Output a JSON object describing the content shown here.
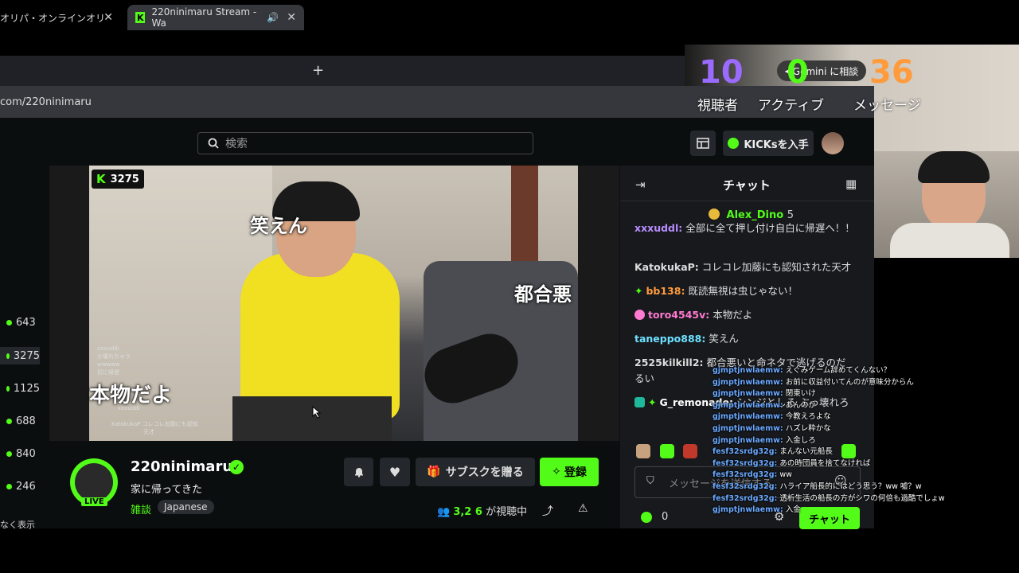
{
  "browser": {
    "tab1_label": "オリパ・オンラインオリパ",
    "tab2_label": "220ninimaru Stream - Wa",
    "tab_close": "✕",
    "new_tab": "+",
    "url": "com/220ninimaru"
  },
  "header": {
    "search_placeholder": "検索",
    "kicks_label": "KICKsを入手"
  },
  "sidebar": {
    "counts": [
      "643",
      "3275",
      "1125",
      "688",
      "840",
      "246"
    ],
    "show_less": "なく表示"
  },
  "video": {
    "viewer_badge": "3275",
    "overlay_1": "笑えん",
    "overlay_2": "都合悪",
    "overlay_3": "本物だよ",
    "mini_chat": [
      "xxxuddl",
      "xxxuddl",
      "か壊れちゃう",
      "wwwww",
      "初に帰遅",
      "KatokukaP コレコレ加藤にも認知",
      "天才"
    ]
  },
  "channel": {
    "name": "220ninimaru",
    "title": "家に帰ってきた",
    "category": "雑談",
    "tag": "Japanese",
    "live": "LIVE",
    "gift_sub": "サブスクを贈る",
    "register": "登録",
    "viewer_count": "3,2 6",
    "watching": "が視聴中"
  },
  "chat": {
    "title": "チャット",
    "pinned_user": "Alex_Dino",
    "pinned_count": "5",
    "messages": [
      {
        "user": "xxxuddl:",
        "text": "全部に全て押し付け自白に帰遅へ！！",
        "color": "#b98cff"
      },
      {
        "user": "KatokukaP:",
        "text": "コレコレ加藤にも認知された天才",
        "color": "#ddd"
      },
      {
        "user": "bb138:",
        "text": "既読無視は虫じゃない！",
        "color": "#ff9b3d"
      },
      {
        "user": "toro4545v:",
        "text": "本物だよ",
        "color": "#ff7ad1"
      },
      {
        "user": "taneppo888:",
        "text": "笑えん",
        "color": "#6de0ff"
      },
      {
        "user": "2525kilkill2:",
        "text": "都合悪いと命ネタで逃げるのだるい",
        "color": "#ddd"
      },
      {
        "user": "G_remonade:",
        "text": "シンジとしろ ぶっ壊れろ",
        "color": "#fff"
      }
    ],
    "input_placeholder": "メッセージを送信する",
    "points": "0",
    "send": "チャット"
  },
  "overlay": {
    "viewers_num": "10",
    "viewers_label": "視聴者",
    "active_num": "0",
    "active_label": "アクティブ",
    "messages_num": "36",
    "messages_label": "メッセージ",
    "gemini": "Gemini に相談",
    "chat_lines": [
      {
        "u": "gjmptjnwlaemw:",
        "t": "えぐみゲーム辞めてくんない？"
      },
      {
        "u": "gjmptjnwlaemw:",
        "t": "お前に収益付いてんのが意味分からん"
      },
      {
        "u": "gjmptjnwlaemw:",
        "t": "閉東いけ"
      },
      {
        "u": "gjmptjnwlaemw:",
        "t": "あんのか"
      },
      {
        "u": "gjmptjnwlaemw:",
        "t": "今教えろよな"
      },
      {
        "u": "gjmptjnwlaemw:",
        "t": "ハズレ粋かな"
      },
      {
        "u": "gjmptjnwlaemw:",
        "t": "入金しろ"
      },
      {
        "u": "fesf32srdg32g:",
        "t": "まんない元船長"
      },
      {
        "u": "fesf32srdg32g:",
        "t": "あの時団員を捨てなければ"
      },
      {
        "u": "fesf32srdg32g:",
        "t": "ww"
      },
      {
        "u": "fesf32srdg32g:",
        "t": "ハライア船長的にはどう思う？ww 嘘？w"
      },
      {
        "u": "fesf32srdg32g:",
        "t": "透析生活の船長の方がシワの何倍も過酷でしょw"
      },
      {
        "u": "gjmptjnwlaemw:",
        "t": "入金"
      }
    ]
  }
}
